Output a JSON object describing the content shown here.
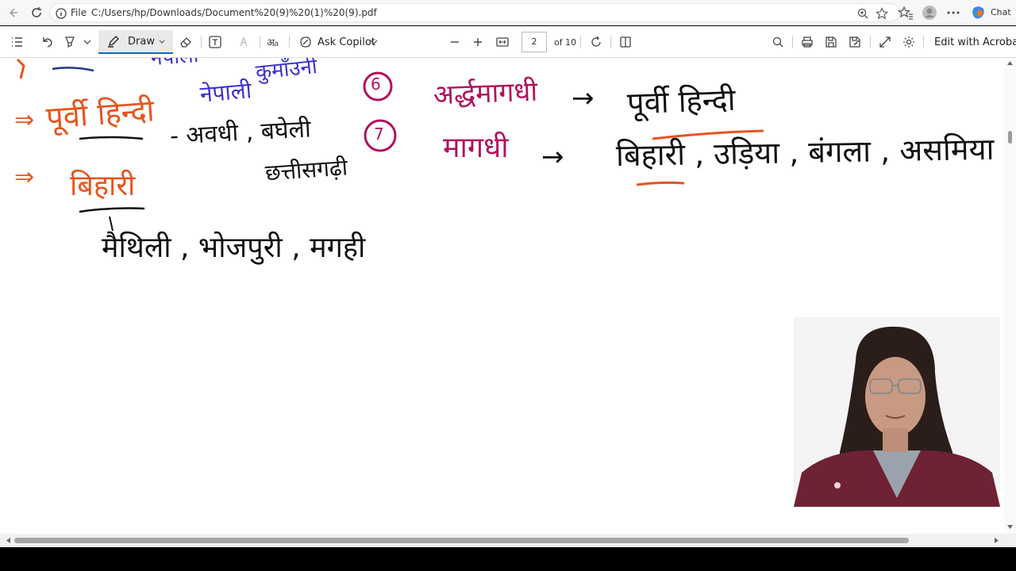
{
  "browser": {
    "file_label": "File",
    "url": "C:/Users/hp/Downloads/Document%20(9)%20(1)%20(9).pdf",
    "chat_label": "Chat"
  },
  "toolbar": {
    "draw_label": "Draw",
    "ask_copilot": "Ask Copilot",
    "page_current": "2",
    "page_total": "of 10",
    "edit_acrobat": "Edit with Acrobat"
  },
  "notes": {
    "cut_top_1": "नेपाली",
    "cut_top_2": "कुमाँउनी",
    "num_6": "6",
    "ardhamagadhi": "अर्द्धमागधी",
    "arrow": "→",
    "purvi_hindi_right": "पूर्वी हिन्दी",
    "purvi_hindi_left": "पूर्वी हिन्दी",
    "dash_awadhi": "- अवधी , बघेली",
    "chhattisgarhi": "छत्तीसगढ़ी",
    "num_7": "7",
    "magadhi": "मागधी",
    "bihari_list": "बिहारी , उड़िया , बंगला , असमिया",
    "bihari_left": "बिहारी",
    "bullet": "⇒",
    "bihari_sub": "मैथिली , भोजपुरी , मगही"
  },
  "colors": {
    "orange": "#e8541e",
    "purple": "#5b21b6",
    "blue": "#3b2fd0",
    "magenta": "#b0125e",
    "black": "#111111",
    "accent": "#0f6cbd"
  }
}
